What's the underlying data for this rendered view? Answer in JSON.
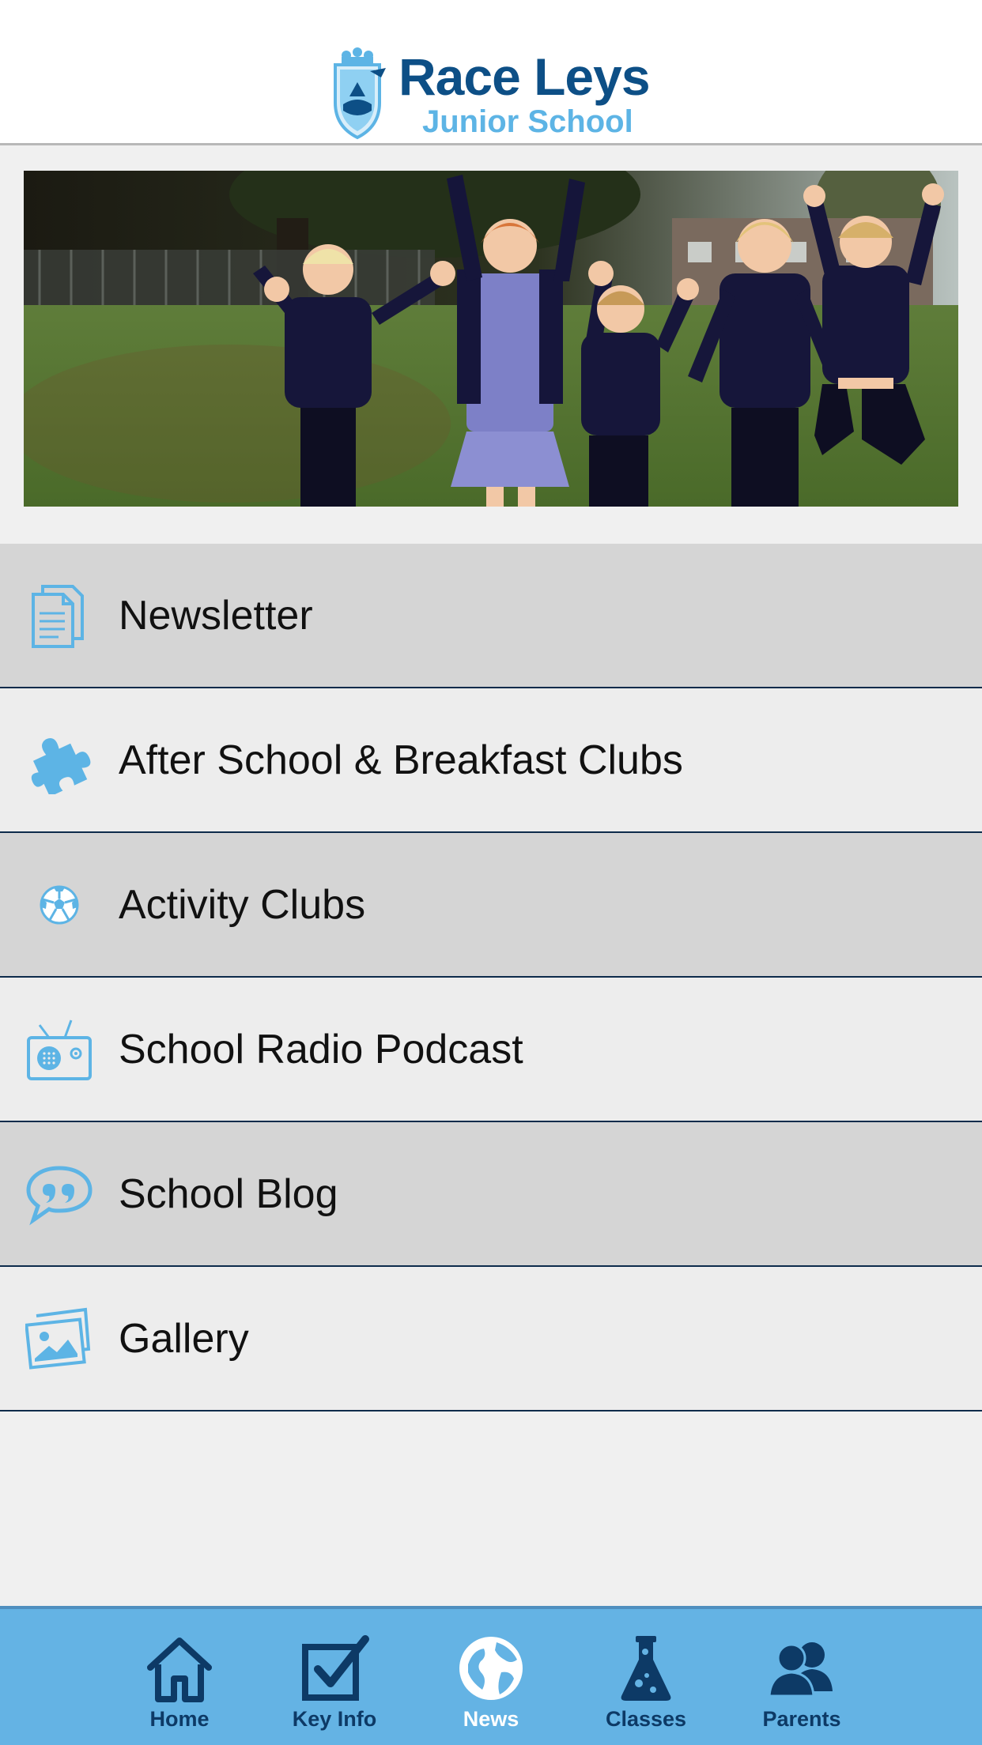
{
  "header": {
    "logo_title": "Race Leys",
    "logo_subtitle": "Junior School"
  },
  "menu": {
    "items": [
      {
        "label": "Newsletter",
        "icon": "newsletter-icon"
      },
      {
        "label": "After School & Breakfast Clubs",
        "icon": "puzzle-icon"
      },
      {
        "label": "Activity Clubs",
        "icon": "football-icon"
      },
      {
        "label": "School Radio Podcast",
        "icon": "radio-icon"
      },
      {
        "label": "School Blog",
        "icon": "speech-bubble-icon"
      },
      {
        "label": "Gallery",
        "icon": "gallery-icon"
      }
    ]
  },
  "tabbar": {
    "tabs": [
      {
        "label": "Home",
        "icon": "home-icon",
        "active": false
      },
      {
        "label": "Key Info",
        "icon": "checkbox-icon",
        "active": false
      },
      {
        "label": "News",
        "icon": "globe-icon",
        "active": true
      },
      {
        "label": "Classes",
        "icon": "flask-icon",
        "active": false
      },
      {
        "label": "Parents",
        "icon": "people-icon",
        "active": false
      }
    ]
  },
  "colors": {
    "brand_dark": "#0d4f86",
    "brand_light": "#5db4e5",
    "tabbar_bg": "#64b3e4",
    "tab_inactive": "#0d3a66",
    "tab_active": "#ffffff",
    "row_dark": "#d5d5d5",
    "row_light": "#ededed",
    "divider": "#0d2b4b"
  }
}
